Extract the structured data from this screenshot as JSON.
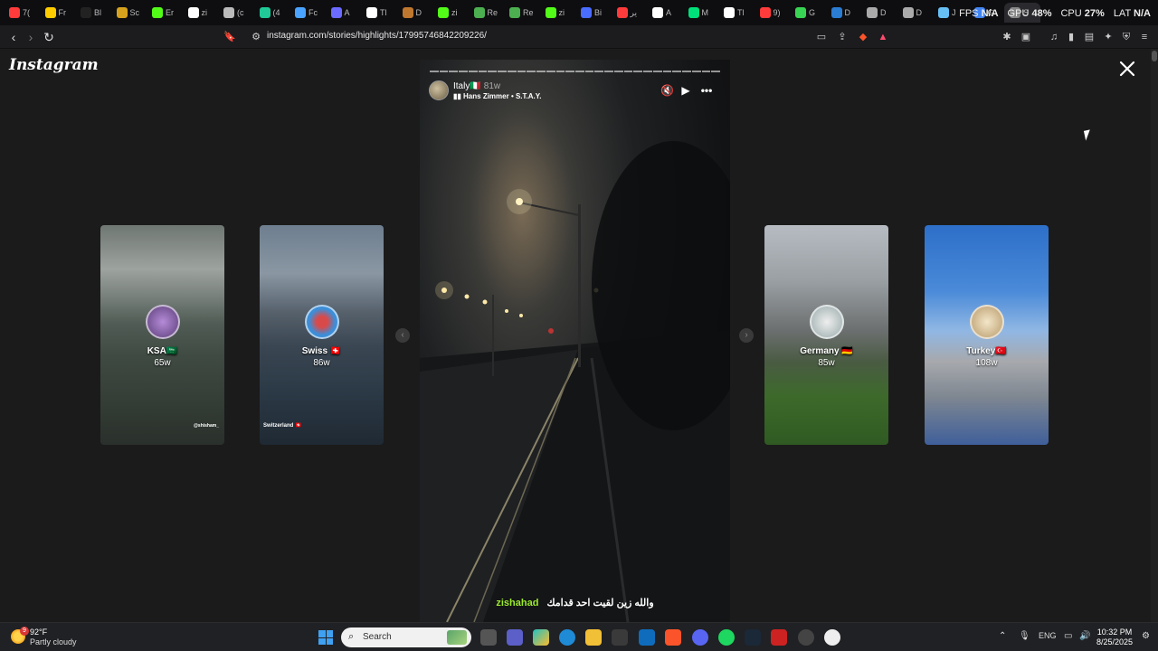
{
  "browser": {
    "tabs": [
      {
        "label": "7(",
        "icon": "youtube-icon",
        "color": "#ff3b3b"
      },
      {
        "label": "Fr",
        "icon": "bulb-icon",
        "color": "#ffcc00"
      },
      {
        "label": "Bl",
        "icon": "circle-icon",
        "color": "#222222"
      },
      {
        "label": "Sc",
        "icon": "coin-icon",
        "color": "#d6a21e"
      },
      {
        "label": "Er",
        "icon": "kick-icon",
        "color": "#53fc18"
      },
      {
        "label": "zi",
        "icon": "diamond-icon",
        "color": "#ffffff"
      },
      {
        "label": "(c",
        "icon": "target-icon",
        "color": "#bbbbbb"
      },
      {
        "label": "(4",
        "icon": "refresh-icon",
        "color": "#20c997"
      },
      {
        "label": "Fc",
        "icon": "v-icon",
        "color": "#4aa3ff"
      },
      {
        "label": "A",
        "icon": "p-icon",
        "color": "#6b6bff"
      },
      {
        "label": "Tl",
        "icon": "diamond-icon",
        "color": "#ffffff"
      },
      {
        "label": "D",
        "icon": "coin-icon",
        "color": "#c0772e"
      },
      {
        "label": "zi",
        "icon": "kick-icon",
        "color": "#53fc18"
      },
      {
        "label": "Re",
        "icon": "leaf-icon",
        "color": "#4caf50"
      },
      {
        "label": "Re",
        "icon": "leaf-icon",
        "color": "#4caf50"
      },
      {
        "label": "zi",
        "icon": "kick-icon",
        "color": "#53fc18"
      },
      {
        "label": "Bi",
        "icon": "info-icon",
        "color": "#4a6cff"
      },
      {
        "label": "ير",
        "icon": "shield-icon",
        "color": "#ff3b3b"
      },
      {
        "label": "A",
        "icon": "a-icon",
        "color": "#ffffff"
      },
      {
        "label": "M",
        "icon": "mk-icon",
        "color": "#00e07a"
      },
      {
        "label": "Tl",
        "icon": "diamond-icon",
        "color": "#ffffff"
      },
      {
        "label": "9)",
        "icon": "youtube-icon",
        "color": "#ff3b3b"
      },
      {
        "label": "G",
        "icon": "check-icon",
        "color": "#39d353"
      },
      {
        "label": "D",
        "icon": "word-icon",
        "color": "#2b7cd3"
      },
      {
        "label": "D",
        "icon": "globe-icon",
        "color": "#aaaaaa"
      },
      {
        "label": "D",
        "icon": "globe-icon",
        "color": "#aaaaaa"
      },
      {
        "label": "J",
        "icon": "steam-icon",
        "color": "#66c0f4"
      },
      {
        "label": "G",
        "icon": "g-icon",
        "color": "#4285f4"
      },
      {
        "label": "S",
        "icon": "s-icon",
        "color": "#888888"
      }
    ],
    "stats": [
      {
        "label": "FPS",
        "value": "N/A"
      },
      {
        "label": "GPU",
        "value": "48%"
      },
      {
        "label": "CPU",
        "value": "27%"
      },
      {
        "label": "LAT",
        "value": "N/A"
      }
    ],
    "url": "instagram.com/stories/highlights/17995746842209226/"
  },
  "page": {
    "logo": "Instagram",
    "cards": [
      {
        "id": "ksa",
        "name": "KSA🇸🇦",
        "age": "65w",
        "caption": "@shisham_"
      },
      {
        "id": "swiss",
        "name": "Swiss 🇨🇭",
        "age": "86w",
        "caption": "Switzerland 🇨🇭"
      },
      {
        "id": "germany",
        "name": "Germany 🇩🇪",
        "age": "85w",
        "caption": ""
      },
      {
        "id": "turkey",
        "name": "Turkey🇹🇷",
        "age": "108w",
        "caption": ""
      }
    ],
    "story": {
      "user": "Italy🇮🇹",
      "ago": "81w",
      "music": "Hans Zimmer • S.T.A.Y.",
      "handle": "zishahad",
      "caption": "والله زين لقيت احد قدامك",
      "segments": 30
    }
  },
  "taskbar": {
    "weather": {
      "temp": "92°F",
      "desc": "Partly cloudy",
      "badge": "9"
    },
    "search_placeholder": "Search",
    "lang": "ENG",
    "time": "10:32 PM",
    "date": "8/25/2025"
  }
}
